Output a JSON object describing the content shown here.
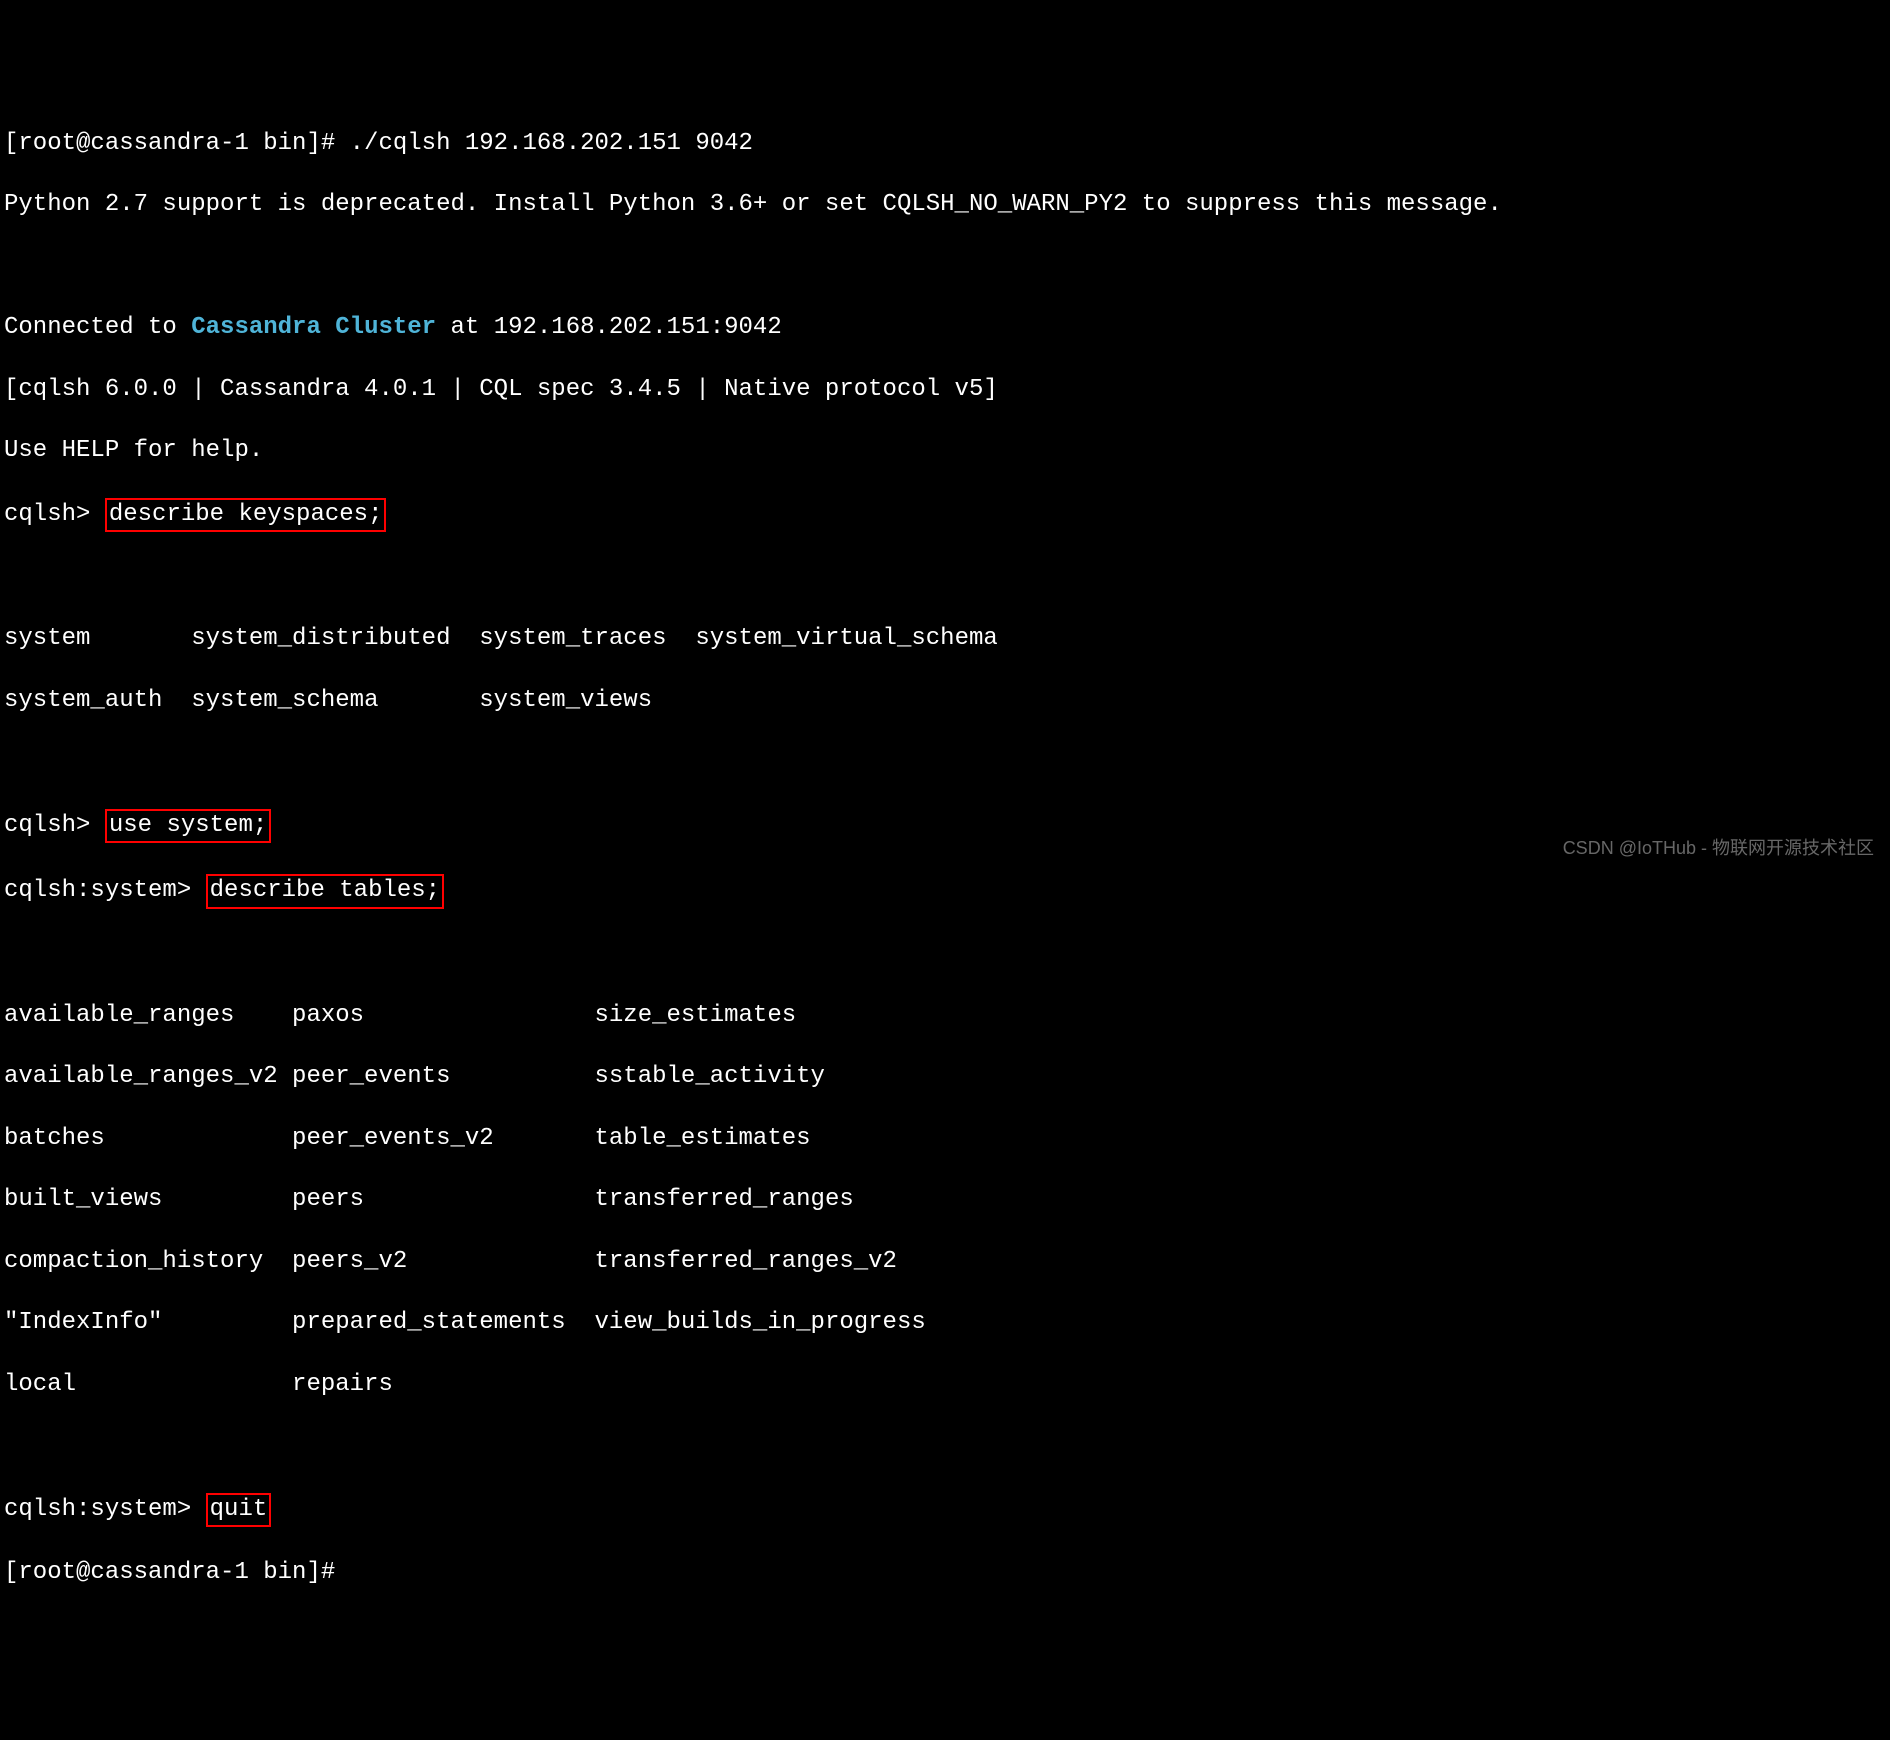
{
  "lines": {
    "shell_prompt1": "[root@cassandra-1 bin]# ",
    "shell_cmd1": "./cqlsh 192.168.202.151 9042",
    "py_warn": "Python 2.7 support is deprecated. Install Python 3.6+ or set CQLSH_NO_WARN_PY2 to suppress this message.",
    "connected_prefix": "Connected to ",
    "cluster_name": "Cassandra Cluster",
    "connected_suffix": " at 192.168.202.151:9042",
    "version_line": "[cqlsh 6.0.0 | Cassandra 4.0.1 | CQL spec 3.4.5 | Native protocol v5]",
    "help_line": "Use HELP for help.",
    "cqlsh_prompt": "cqlsh> ",
    "cmd_describe_keyspaces": "describe keyspaces;",
    "keyspaces_col1_row1": "system       ",
    "keyspaces_col1_row2": "system_auth  ",
    "keyspaces_col2_row1": "system_distributed  ",
    "keyspaces_col2_row2": "system_schema       ",
    "keyspaces_col3_row1": "system_traces  ",
    "keyspaces_col3_row2": "system_views   ",
    "keyspaces_col4_row1": "system_virtual_schema",
    "cmd_use_system": "use system;",
    "cqlsh_system_prompt": "cqlsh:system> ",
    "cmd_describe_tables": "describe tables;",
    "tables_col1": [
      "available_ranges    ",
      "available_ranges_v2 ",
      "batches             ",
      "built_views         ",
      "compaction_history  ",
      "\"IndexInfo\"         ",
      "local               "
    ],
    "tables_col2": [
      "paxos                ",
      "peer_events          ",
      "peer_events_v2       ",
      "peers                ",
      "peers_v2             ",
      "prepared_statements  ",
      "repairs              "
    ],
    "tables_col3": [
      "size_estimates",
      "sstable_activity",
      "table_estimates",
      "transferred_ranges",
      "transferred_ranges_v2",
      "view_builds_in_progress",
      ""
    ],
    "cmd_quit": "quit",
    "shell_prompt2": "[root@cassandra-1 bin]# "
  },
  "watermark": "CSDN @IoTHub - 物联网开源技术社区"
}
